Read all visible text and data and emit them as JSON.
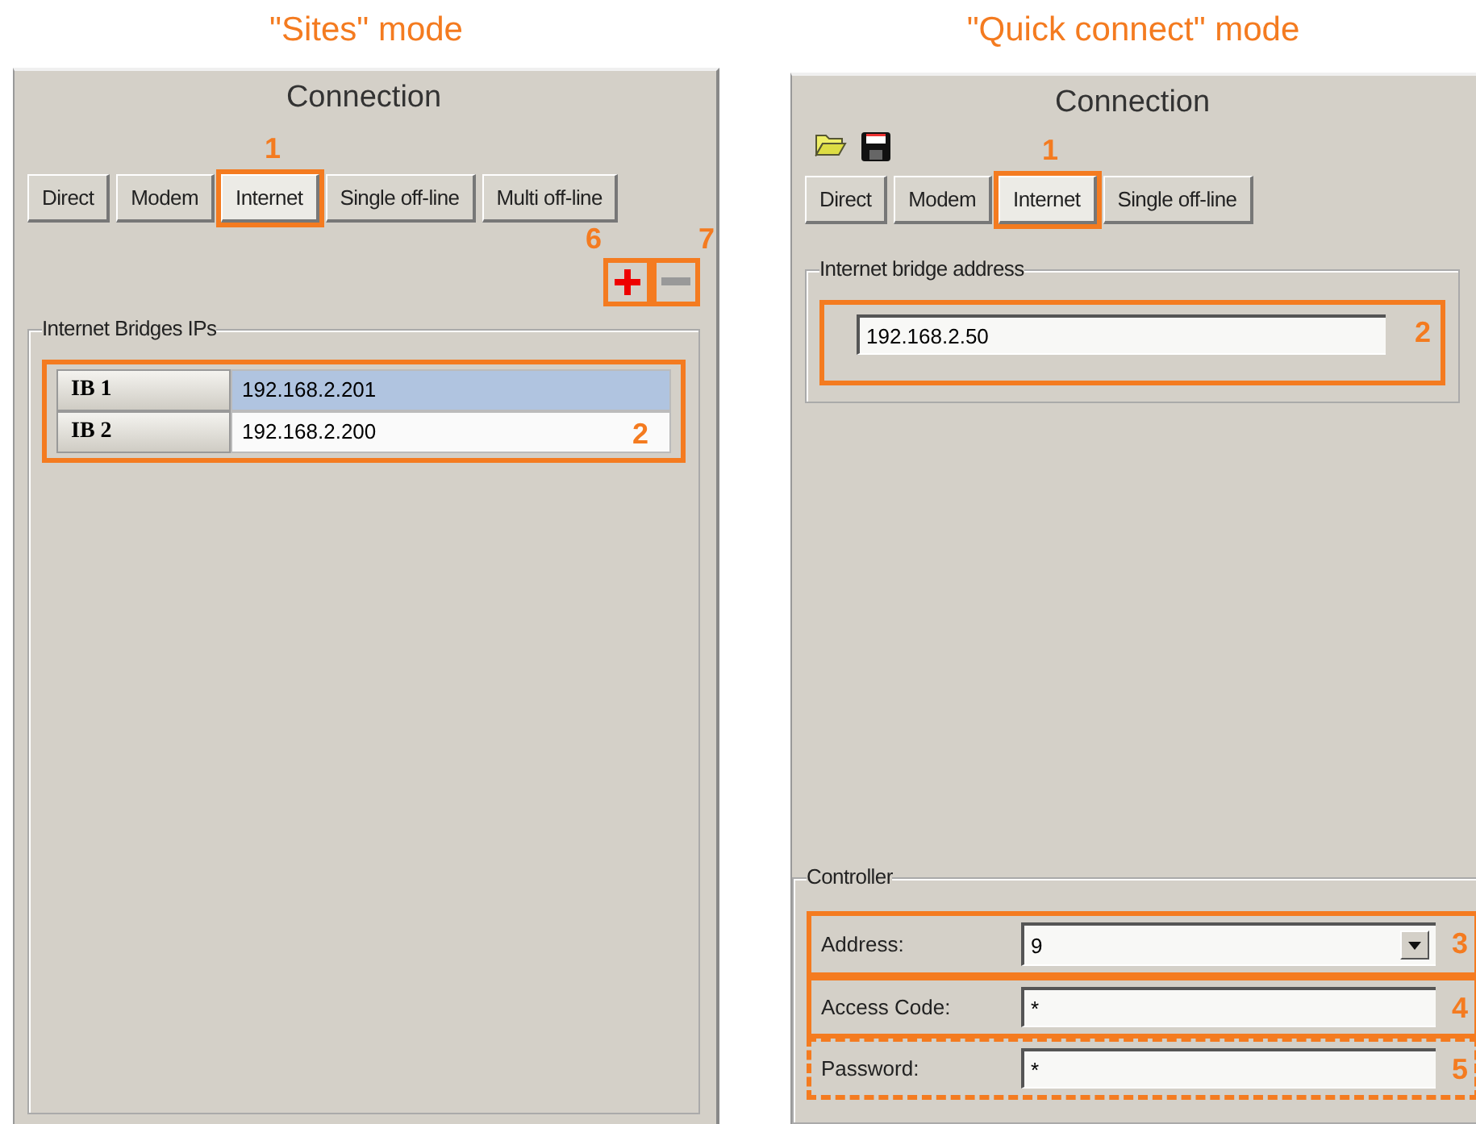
{
  "sites_panel": {
    "caption": "\"Sites\" mode",
    "title": "Connection",
    "tabs": [
      {
        "label": "Direct",
        "selected": false
      },
      {
        "label": "Modem",
        "selected": false
      },
      {
        "label": "Internet",
        "selected": true,
        "callout": "1"
      },
      {
        "label": "Single off-line",
        "selected": false
      },
      {
        "label": "Multi off-line",
        "selected": false
      }
    ],
    "add_button": {
      "callout": "6",
      "disabled": false
    },
    "remove_button": {
      "callout": "7",
      "disabled": true
    },
    "group_title": "Internet Bridges IPs",
    "table_callout": "2",
    "rows": [
      {
        "name": "IB 1",
        "address": "192.168.2.201",
        "selected": true
      },
      {
        "name": "IB 2",
        "address": "192.168.2.200",
        "selected": false
      }
    ]
  },
  "quick_panel": {
    "caption": "\"Quick connect\" mode",
    "title": "Connection",
    "tabs": [
      {
        "label": "Direct",
        "selected": false
      },
      {
        "label": "Modem",
        "selected": false
      },
      {
        "label": "Internet",
        "selected": true,
        "callout": "1"
      },
      {
        "label": "Single off-line",
        "selected": false
      }
    ],
    "bridge_group": {
      "title": "Internet bridge address",
      "value": "192.168.2.50",
      "callout": "2"
    },
    "controller": {
      "title": "Controller",
      "fields": [
        {
          "kind": "dropdown",
          "label": "Address:",
          "value": "9",
          "callout": "3",
          "dashed": false
        },
        {
          "kind": "text",
          "label": "Access Code:",
          "value": "*",
          "callout": "4",
          "dashed": false
        },
        {
          "kind": "text",
          "label": "Password:",
          "value": "*",
          "callout": "5",
          "dashed": true
        }
      ]
    }
  }
}
